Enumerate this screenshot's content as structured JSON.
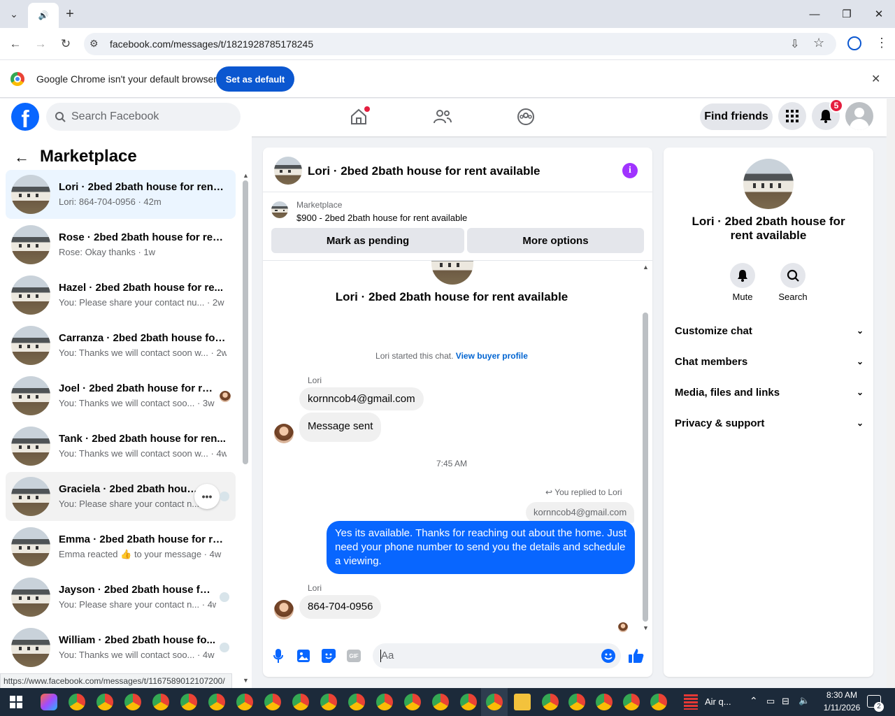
{
  "browser": {
    "url": "facebook.com/messages/t/1821928785178245",
    "infobar_text": "Google Chrome isn't your default browser",
    "set_default_label": "Set as default",
    "status_url": "https://www.facebook.com/messages/t/1167589012107200/"
  },
  "header": {
    "search_placeholder": "Search Facebook",
    "find_friends": "Find friends",
    "notif_count": "5"
  },
  "sidebar": {
    "title": "Marketplace",
    "conversations": [
      {
        "name": "Lori · 2bed 2bath house for rent ...",
        "snippet": "Lori: 864-704-0956 · 42m"
      },
      {
        "name": "Rose · 2bed 2bath house for ren...",
        "snippet": "Rose: Okay thanks · 1w"
      },
      {
        "name": "Hazel · 2bed 2bath house for re...",
        "snippet": "You: Please share your contact nu... · 2w"
      },
      {
        "name": "Carranza · 2bed 2bath house for...",
        "snippet": "You: Thanks we will contact soon w... · 2w"
      },
      {
        "name": "Joel · 2bed 2bath house for re...",
        "snippet": "You: Thanks we will contact soo... · 3w"
      },
      {
        "name": "Tank · 2bed 2bath house for ren...",
        "snippet": "You: Thanks we will contact soon w... · 4w"
      },
      {
        "name": "Graciela · 2bed 2bath house f...",
        "snippet": "You: Please share your contact n..."
      },
      {
        "name": "Emma · 2bed 2bath house for re...",
        "snippet": "Emma reacted 👍 to your message · 4w"
      },
      {
        "name": "Jayson · 2bed 2bath house for...",
        "snippet": "You: Please share your contact n... · 4w"
      },
      {
        "name": "William · 2bed 2bath house fo...",
        "snippet": "You: Thanks we will contact soo... · 4w"
      }
    ]
  },
  "chat": {
    "title": "Lori · 2bed 2bath house for rent available",
    "marketplace_label": "Marketplace",
    "listing": "$900 - 2bed 2bath house for rent available",
    "mark_pending": "Mark as pending",
    "more_options": "More options",
    "big_title": "Lori · 2bed 2bath house for rent available",
    "started_text": "Lori started this chat.",
    "view_profile": "View buyer profile",
    "sender1": "Lori",
    "msg1": "kornncob4@gmail.com",
    "msg2": "Message sent",
    "timestamp": "7:45 AM",
    "replied_to": "You replied to Lori",
    "quoted": "kornncob4@gmail.com",
    "my_msg": "Yes its available. Thanks for reaching out about the home. Just need your phone number to send you the details and schedule a viewing.",
    "sender2": "Lori",
    "msg3": "864-704-0956",
    "composer_placeholder": "Aa"
  },
  "details": {
    "name": "Lori · 2bed 2bath house for rent available",
    "mute": "Mute",
    "search": "Search",
    "items": [
      "Customize chat",
      "Chat members",
      "Media, files and links",
      "Privacy & support"
    ]
  },
  "taskbar": {
    "weather": "Air q...",
    "time": "8:30 AM",
    "date": "1/11/2026",
    "notif": "2"
  }
}
